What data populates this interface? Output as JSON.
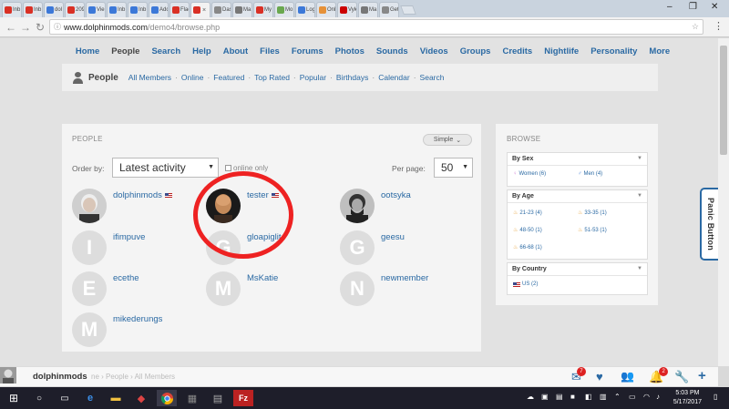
{
  "browser": {
    "tabs": [
      {
        "label": "Inb",
        "color": "#d93025"
      },
      {
        "label": "Inb",
        "color": "#d93025"
      },
      {
        "label": "dol",
        "color": "#3c78d8"
      },
      {
        "label": "209",
        "color": "#d93025"
      },
      {
        "label": "Vie",
        "color": "#3c78d8"
      },
      {
        "label": "Inb",
        "color": "#3c78d8"
      },
      {
        "label": "Inb",
        "color": "#3c78d8"
      },
      {
        "label": "Adc",
        "color": "#3c78d8"
      },
      {
        "label": "Flac",
        "color": "#d93025"
      },
      {
        "label": "",
        "color": "#d93025",
        "active": true
      },
      {
        "label": "Das",
        "color": "#888888"
      },
      {
        "label": "Ma",
        "color": "#777777"
      },
      {
        "label": "My",
        "color": "#d93025"
      },
      {
        "label": "Mo",
        "color": "#6aa84f"
      },
      {
        "label": "Log",
        "color": "#3c78d8"
      },
      {
        "label": "Onl",
        "color": "#e69138"
      },
      {
        "label": "Vyk",
        "color": "#cc0000"
      },
      {
        "label": "Ma",
        "color": "#777777"
      },
      {
        "label": "Get",
        "color": "#888888"
      }
    ],
    "url_domain": "www.dolphinmods.com",
    "url_path": "/demo4/browse.php"
  },
  "main_nav": [
    "Home",
    "People",
    "Search",
    "Help",
    "About",
    "Files",
    "Forums",
    "Photos",
    "Sounds",
    "Videos",
    "Groups",
    "Credits",
    "Nightlife",
    "Personality",
    "More"
  ],
  "sub_nav": {
    "title": "People",
    "links": [
      "All Members",
      "Online",
      "Featured",
      "Top Rated",
      "Popular",
      "Birthdays",
      "Calendar",
      "Search"
    ]
  },
  "people_panel": {
    "header": "PEOPLE",
    "view_mode": "Simple",
    "order_by_label": "Order by:",
    "order_by_value": "Latest activity",
    "online_only_label": "online only",
    "per_page_label": "Per page:",
    "per_page_value": "50",
    "members": [
      {
        "name": "dolphinmods",
        "initial": "",
        "flag": true,
        "photo": "oldman"
      },
      {
        "name": "tester",
        "initial": "",
        "flag": true,
        "photo": "bald"
      },
      {
        "name": "ootsyka",
        "initial": "",
        "flag": false,
        "photo": "lincoln"
      },
      {
        "name": "ifimpuve",
        "initial": "I",
        "flag": false
      },
      {
        "name": "gloapiglit",
        "initial": "G",
        "flag": false
      },
      {
        "name": "geesu",
        "initial": "G",
        "flag": false
      },
      {
        "name": "ecethe",
        "initial": "E",
        "flag": false
      },
      {
        "name": "MsKatie",
        "initial": "M",
        "flag": false
      },
      {
        "name": "newmember",
        "initial": "N",
        "flag": false
      },
      {
        "name": "mikederungs",
        "initial": "M",
        "flag": false
      }
    ]
  },
  "browse_panel": {
    "header": "BROWSE",
    "by_sex": {
      "title": "By Sex",
      "items": [
        "Women (6)",
        "Men (4)"
      ]
    },
    "by_age": {
      "title": "By Age",
      "items": [
        "21-23 (4)",
        "33-35 (1)",
        "48-50 (1)",
        "51-53 (1)",
        "66-68 (1)"
      ]
    },
    "by_country": {
      "title": "By Country",
      "items": [
        "US (2)"
      ]
    }
  },
  "panic_button": "Panic Button",
  "bottom_bar": {
    "username": "dolphinmods",
    "breadcrumb": "ne  ›  People  ›  All Members",
    "mail_badge": "7",
    "notify_badge": "2"
  },
  "taskbar": {
    "time": "5:03 PM",
    "date": "5/17/2017"
  }
}
